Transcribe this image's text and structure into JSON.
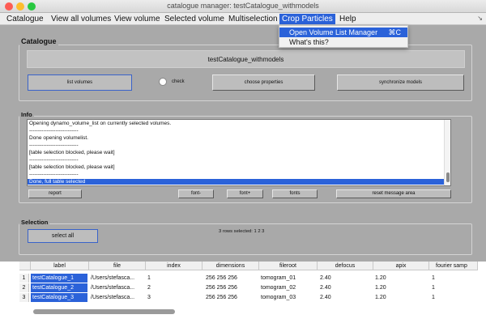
{
  "window": {
    "title": "catalogue manager: testCatalogue_withmodels"
  },
  "colors": {
    "close": "#fd5c54",
    "minimize": "#fdbd2e",
    "zoom": "#28c840",
    "accent": "#2b62d9"
  },
  "menubar": {
    "items": [
      "Catalogue",
      "View all volumes",
      "View volume",
      "Selected volume",
      "Multiselection",
      "Crop Particles",
      "Help"
    ],
    "active": "Crop Particles",
    "grip": "↘"
  },
  "dropdown": {
    "items": [
      {
        "label": "Open Volume List Manager",
        "shortcut": "⌘C"
      },
      {
        "label": "What's this?",
        "shortcut": ""
      }
    ]
  },
  "catalogue": {
    "section_label": "Catalogue",
    "name": "testCatalogue_withmodels",
    "list_volumes": "list volumes",
    "check_label": "check",
    "choose_properties": "choose properties",
    "synchronize_models": "synchronize models"
  },
  "info": {
    "section_label": "Info",
    "lines": [
      "Opening dynamo_volume_list on currently selected volumes.",
      "----------------------------",
      "Done opening volumelist.",
      "----------------------------",
      "[table selection blocked,  please wait]",
      "----------------------------",
      "[table selection blocked,  please wait]",
      "----------------------------",
      "Done, full table selected"
    ],
    "buttons": {
      "report": "report",
      "font_minus": "font-",
      "font_plus": "font+",
      "fonts": "fonts",
      "reset": "reset message area"
    }
  },
  "selection": {
    "section_label": "Selection",
    "select_all": "select all",
    "status": "3 rows selected: 1 2 3"
  },
  "table": {
    "columns": [
      "label",
      "file",
      "index",
      "dimensions",
      "fileroot",
      "defocus",
      "apix",
      "fourier samp"
    ],
    "rows": [
      {
        "n": "1",
        "label": "testCatalogue_1",
        "file": "/Users/stefasca...",
        "index": "1",
        "dimensions": "256 256 256",
        "fileroot": "tomogram_01",
        "defocus": "2.40",
        "apix": "1.20",
        "fourier": "1"
      },
      {
        "n": "2",
        "label": "testCatalogue_2",
        "file": "/Users/stefasca...",
        "index": "2",
        "dimensions": "256 256 256",
        "fileroot": "tomogram_02",
        "defocus": "2.40",
        "apix": "1.20",
        "fourier": "1"
      },
      {
        "n": "3",
        "label": "testCatalogue_3",
        "file": "/Users/stefasca...",
        "index": "3",
        "dimensions": "256 256 256",
        "fileroot": "tomogram_03",
        "defocus": "2.40",
        "apix": "1.20",
        "fourier": "1"
      }
    ]
  }
}
